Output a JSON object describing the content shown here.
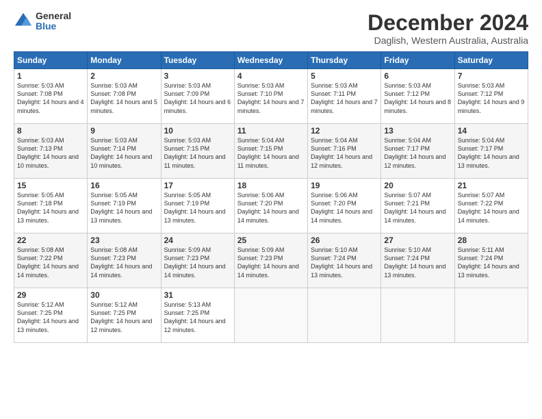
{
  "logo": {
    "general": "General",
    "blue": "Blue"
  },
  "calendar": {
    "title": "December 2024",
    "subtitle": "Daglish, Western Australia, Australia",
    "headers": [
      "Sunday",
      "Monday",
      "Tuesday",
      "Wednesday",
      "Thursday",
      "Friday",
      "Saturday"
    ],
    "weeks": [
      [
        {
          "day": "1",
          "sunrise": "Sunrise: 5:03 AM",
          "sunset": "Sunset: 7:08 PM",
          "daylight": "Daylight: 14 hours and 4 minutes."
        },
        {
          "day": "2",
          "sunrise": "Sunrise: 5:03 AM",
          "sunset": "Sunset: 7:08 PM",
          "daylight": "Daylight: 14 hours and 5 minutes."
        },
        {
          "day": "3",
          "sunrise": "Sunrise: 5:03 AM",
          "sunset": "Sunset: 7:09 PM",
          "daylight": "Daylight: 14 hours and 6 minutes."
        },
        {
          "day": "4",
          "sunrise": "Sunrise: 5:03 AM",
          "sunset": "Sunset: 7:10 PM",
          "daylight": "Daylight: 14 hours and 7 minutes."
        },
        {
          "day": "5",
          "sunrise": "Sunrise: 5:03 AM",
          "sunset": "Sunset: 7:11 PM",
          "daylight": "Daylight: 14 hours and 7 minutes."
        },
        {
          "day": "6",
          "sunrise": "Sunrise: 5:03 AM",
          "sunset": "Sunset: 7:12 PM",
          "daylight": "Daylight: 14 hours and 8 minutes."
        },
        {
          "day": "7",
          "sunrise": "Sunrise: 5:03 AM",
          "sunset": "Sunset: 7:12 PM",
          "daylight": "Daylight: 14 hours and 9 minutes."
        }
      ],
      [
        {
          "day": "8",
          "sunrise": "Sunrise: 5:03 AM",
          "sunset": "Sunset: 7:13 PM",
          "daylight": "Daylight: 14 hours and 10 minutes."
        },
        {
          "day": "9",
          "sunrise": "Sunrise: 5:03 AM",
          "sunset": "Sunset: 7:14 PM",
          "daylight": "Daylight: 14 hours and 10 minutes."
        },
        {
          "day": "10",
          "sunrise": "Sunrise: 5:03 AM",
          "sunset": "Sunset: 7:15 PM",
          "daylight": "Daylight: 14 hours and 11 minutes."
        },
        {
          "day": "11",
          "sunrise": "Sunrise: 5:04 AM",
          "sunset": "Sunset: 7:15 PM",
          "daylight": "Daylight: 14 hours and 11 minutes."
        },
        {
          "day": "12",
          "sunrise": "Sunrise: 5:04 AM",
          "sunset": "Sunset: 7:16 PM",
          "daylight": "Daylight: 14 hours and 12 minutes."
        },
        {
          "day": "13",
          "sunrise": "Sunrise: 5:04 AM",
          "sunset": "Sunset: 7:17 PM",
          "daylight": "Daylight: 14 hours and 12 minutes."
        },
        {
          "day": "14",
          "sunrise": "Sunrise: 5:04 AM",
          "sunset": "Sunset: 7:17 PM",
          "daylight": "Daylight: 14 hours and 13 minutes."
        }
      ],
      [
        {
          "day": "15",
          "sunrise": "Sunrise: 5:05 AM",
          "sunset": "Sunset: 7:18 PM",
          "daylight": "Daylight: 14 hours and 13 minutes."
        },
        {
          "day": "16",
          "sunrise": "Sunrise: 5:05 AM",
          "sunset": "Sunset: 7:19 PM",
          "daylight": "Daylight: 14 hours and 13 minutes."
        },
        {
          "day": "17",
          "sunrise": "Sunrise: 5:05 AM",
          "sunset": "Sunset: 7:19 PM",
          "daylight": "Daylight: 14 hours and 13 minutes."
        },
        {
          "day": "18",
          "sunrise": "Sunrise: 5:06 AM",
          "sunset": "Sunset: 7:20 PM",
          "daylight": "Daylight: 14 hours and 14 minutes."
        },
        {
          "day": "19",
          "sunrise": "Sunrise: 5:06 AM",
          "sunset": "Sunset: 7:20 PM",
          "daylight": "Daylight: 14 hours and 14 minutes."
        },
        {
          "day": "20",
          "sunrise": "Sunrise: 5:07 AM",
          "sunset": "Sunset: 7:21 PM",
          "daylight": "Daylight: 14 hours and 14 minutes."
        },
        {
          "day": "21",
          "sunrise": "Sunrise: 5:07 AM",
          "sunset": "Sunset: 7:22 PM",
          "daylight": "Daylight: 14 hours and 14 minutes."
        }
      ],
      [
        {
          "day": "22",
          "sunrise": "Sunrise: 5:08 AM",
          "sunset": "Sunset: 7:22 PM",
          "daylight": "Daylight: 14 hours and 14 minutes."
        },
        {
          "day": "23",
          "sunrise": "Sunrise: 5:08 AM",
          "sunset": "Sunset: 7:23 PM",
          "daylight": "Daylight: 14 hours and 14 minutes."
        },
        {
          "day": "24",
          "sunrise": "Sunrise: 5:09 AM",
          "sunset": "Sunset: 7:23 PM",
          "daylight": "Daylight: 14 hours and 14 minutes."
        },
        {
          "day": "25",
          "sunrise": "Sunrise: 5:09 AM",
          "sunset": "Sunset: 7:23 PM",
          "daylight": "Daylight: 14 hours and 14 minutes."
        },
        {
          "day": "26",
          "sunrise": "Sunrise: 5:10 AM",
          "sunset": "Sunset: 7:24 PM",
          "daylight": "Daylight: 14 hours and 13 minutes."
        },
        {
          "day": "27",
          "sunrise": "Sunrise: 5:10 AM",
          "sunset": "Sunset: 7:24 PM",
          "daylight": "Daylight: 14 hours and 13 minutes."
        },
        {
          "day": "28",
          "sunrise": "Sunrise: 5:11 AM",
          "sunset": "Sunset: 7:24 PM",
          "daylight": "Daylight: 14 hours and 13 minutes."
        }
      ],
      [
        {
          "day": "29",
          "sunrise": "Sunrise: 5:12 AM",
          "sunset": "Sunset: 7:25 PM",
          "daylight": "Daylight: 14 hours and 13 minutes."
        },
        {
          "day": "30",
          "sunrise": "Sunrise: 5:12 AM",
          "sunset": "Sunset: 7:25 PM",
          "daylight": "Daylight: 14 hours and 12 minutes."
        },
        {
          "day": "31",
          "sunrise": "Sunrise: 5:13 AM",
          "sunset": "Sunset: 7:25 PM",
          "daylight": "Daylight: 14 hours and 12 minutes."
        },
        null,
        null,
        null,
        null
      ]
    ]
  }
}
